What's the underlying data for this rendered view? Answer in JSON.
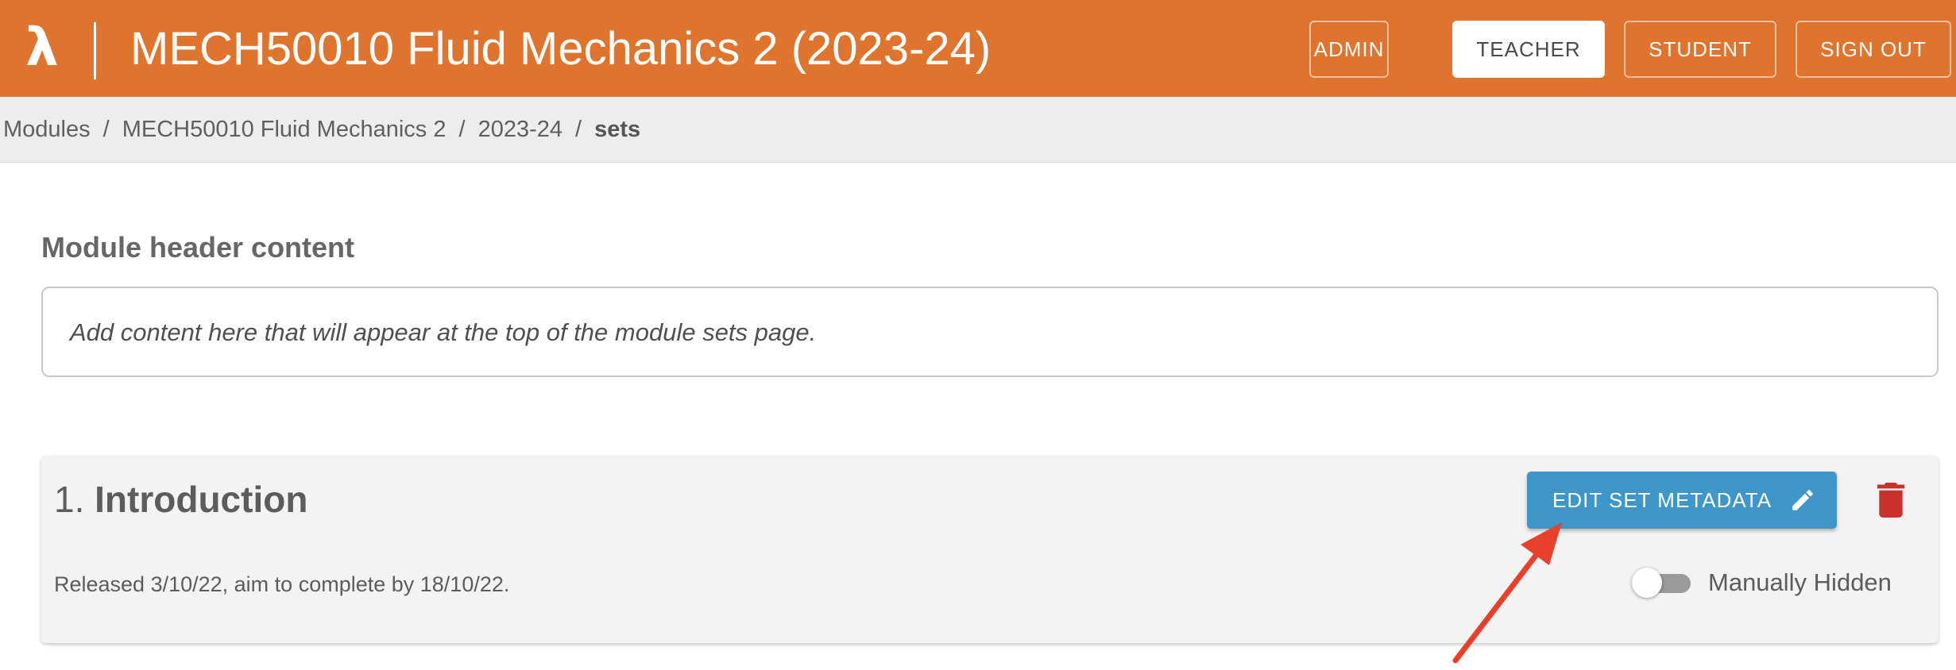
{
  "header": {
    "logo_symbol": "λ",
    "title": "MECH50010 Fluid Mechanics 2 (2023-24)",
    "nav_buttons": [
      {
        "label": "ADMIN",
        "active": false
      },
      {
        "label": "TEACHER",
        "active": true
      },
      {
        "label": "STUDENT",
        "active": false
      },
      {
        "label": "SIGN OUT",
        "active": false
      }
    ]
  },
  "breadcrumb": {
    "items": [
      "Modules",
      "MECH50010 Fluid Mechanics 2",
      "2023-24"
    ],
    "separator": "/",
    "current": "sets"
  },
  "module_header": {
    "heading": "Module header content",
    "placeholder": "Add content here that will appear at the top of the module sets page."
  },
  "sets": [
    {
      "number": "1.",
      "title": "Introduction",
      "release_text": "Released 3/10/22, aim to complete by 18/10/22.",
      "edit_label": "EDIT SET METADATA",
      "hidden_label": "Manually Hidden",
      "manually_hidden": false
    }
  ],
  "icons": {
    "edit": "pencil-icon",
    "delete": "trash-icon",
    "annotation": "red-arrow-pointing-to-edit-button"
  },
  "colors": {
    "header_bg": "#DE742E",
    "edit_button_bg": "#3F96C8",
    "delete_icon": "#C9312C",
    "annotation_arrow": "#E8402A"
  }
}
